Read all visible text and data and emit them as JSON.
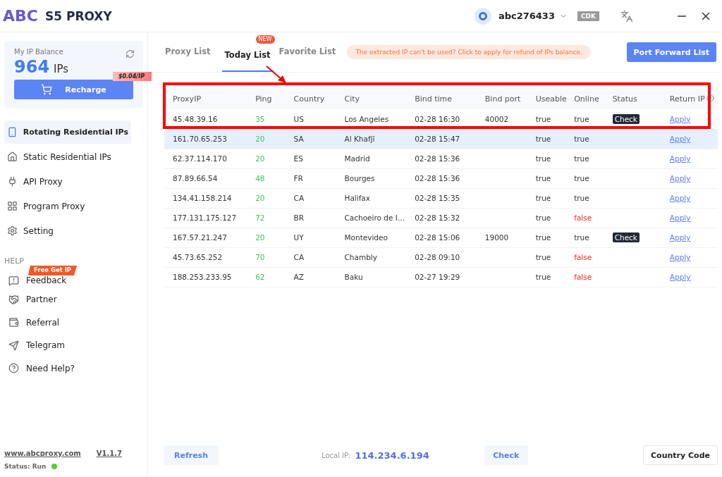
{
  "app": {
    "logo": "ABC",
    "title": "S5 PROXY"
  },
  "user": {
    "name": "abc276433",
    "cdk": "CDK"
  },
  "balance": {
    "label": "My IP Balance",
    "amount": "964",
    "unit": "IPs",
    "price_tag": "$0.04/IP",
    "recharge": "Recharge"
  },
  "sidebar": {
    "items": [
      {
        "label": "Rotating Residential IPs",
        "kind": "phone",
        "selected": true
      },
      {
        "label": "Static Residential IPs",
        "kind": "home",
        "selected": false
      },
      {
        "label": "API Proxy",
        "kind": "plug",
        "selected": false
      },
      {
        "label": "Program Proxy",
        "kind": "grid",
        "selected": false
      },
      {
        "label": "Setting",
        "kind": "gear",
        "selected": false
      }
    ],
    "help_heading": "HELP",
    "help_items": [
      {
        "label": "Feedback",
        "kind": "feedback",
        "badge": "Free Get IP"
      },
      {
        "label": "Partner",
        "kind": "handshake"
      },
      {
        "label": "Referral",
        "kind": "wallet"
      },
      {
        "label": "Telegram",
        "kind": "send"
      },
      {
        "label": "Need Help?",
        "kind": "question"
      }
    ],
    "website": "www.abcproxy.com",
    "version": "V1.1.7",
    "status": "Status: Run"
  },
  "tabs": [
    {
      "label": "Proxy List",
      "selected": false
    },
    {
      "label": "Today List",
      "selected": true,
      "badge": "NEW"
    },
    {
      "label": "Favorite List",
      "selected": false
    }
  ],
  "notice": "The extracted IP can't be used? Click to apply for refund of IPs balance.",
  "port_forward_button": "Port Forward List",
  "table": {
    "columns": [
      "ProxyIP",
      "Ping",
      "Country",
      "City",
      "Bind time",
      "Bind port",
      "Useable",
      "Online",
      "Status",
      "Return IP"
    ],
    "rows": [
      {
        "ip": "45.48.39.16",
        "ping": "35",
        "country": "US",
        "city": "Los Angeles",
        "bind_time": "02-28 16:30",
        "bind_port": "40002",
        "useable": "true",
        "online": "true",
        "offline": false,
        "status": "Check",
        "return": "Apply",
        "selected": false
      },
      {
        "ip": "161.70.65.253",
        "ping": "20",
        "country": "SA",
        "city": "Al Khafjī",
        "bind_time": "02-28 15:47",
        "useable": "true",
        "online": "true",
        "offline": false,
        "return": "Apply",
        "selected": true
      },
      {
        "ip": "62.37.114.170",
        "ping": "20",
        "country": "ES",
        "city": "Madrid",
        "bind_time": "02-28 15:36",
        "useable": "true",
        "online": "true",
        "offline": false,
        "return": "Apply",
        "selected": false
      },
      {
        "ip": "87.89.66.54",
        "ping": "48",
        "country": "FR",
        "city": "Bourges",
        "bind_time": "02-28 15:36",
        "useable": "true",
        "online": "true",
        "offline": false,
        "return": "Apply",
        "selected": false
      },
      {
        "ip": "134.41.158.214",
        "ping": "20",
        "country": "CA",
        "city": "Halifax",
        "bind_time": "02-28 15:35",
        "useable": "true",
        "online": "true",
        "offline": false,
        "return": "Apply",
        "selected": false
      },
      {
        "ip": "177.131.175.127",
        "ping": "72",
        "country": "BR",
        "city": "Cachoeiro de I...",
        "bind_time": "02-28 15:32",
        "useable": "true",
        "online": "false",
        "offline": true,
        "return": "Apply",
        "selected": false
      },
      {
        "ip": "167.57.21.247",
        "ping": "20",
        "country": "UY",
        "city": "Montevideo",
        "bind_time": "02-28 15:06",
        "bind_port": "19000",
        "useable": "true",
        "online": "true",
        "offline": false,
        "status": "Check",
        "return": "Apply",
        "selected": false
      },
      {
        "ip": "45.73.65.252",
        "ping": "70",
        "country": "CA",
        "city": "Chambly",
        "bind_time": "02-28 09:10",
        "useable": "true",
        "online": "false",
        "offline": true,
        "return": "Apply",
        "selected": false
      },
      {
        "ip": "188.253.233.95",
        "ping": "62",
        "country": "AZ",
        "city": "Baku",
        "bind_time": "02-27 19:29",
        "useable": "true",
        "online": "false",
        "offline": true,
        "return": "Apply",
        "selected": false
      }
    ]
  },
  "footer": {
    "refresh": "Refresh",
    "local_ip_label": "Local IP:",
    "local_ip": "114.234.6.194",
    "check": "Check",
    "country_code": "Country Code"
  }
}
